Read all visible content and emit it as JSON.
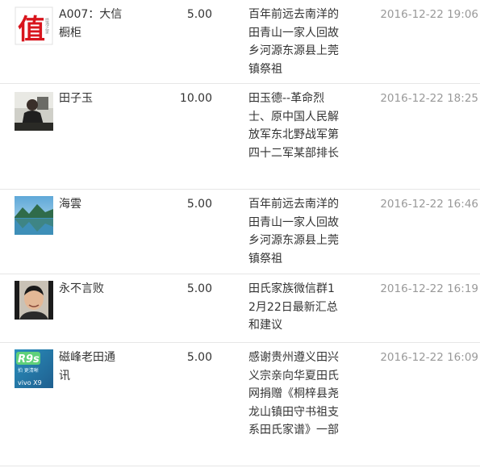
{
  "rows": [
    {
      "avatar": "zhi-calligraphy-avatar-icon",
      "name": "A007：大信橱柜",
      "amount": "5.00",
      "message": "百年前远去南洋的田青山一家人回故乡河源东源县上莞镇祭祖",
      "time": "2016-12-22 19:06"
    },
    {
      "avatar": "person-photo-avatar-icon",
      "name": "田子玉",
      "amount": "10.00",
      "message": "田玉德--革命烈士、原中国人民解放军东北野战军第四十二军某部排长",
      "time": "2016-12-22 18:25"
    },
    {
      "avatar": "mountain-lake-avatar-icon",
      "name": "海雲",
      "amount": "5.00",
      "message": "百年前远去南洋的田青山一家人回故乡河源东源县上莞镇祭祖",
      "time": "2016-12-22 16:46"
    },
    {
      "avatar": "man-portrait-avatar-icon",
      "name": "永不言败",
      "amount": "5.00",
      "message": "田氏家族微信群12月22日最新汇总和建议",
      "time": "2016-12-22 16:19"
    },
    {
      "avatar": "vivo-r9s-avatar-icon",
      "name": "磁峰老田通讯",
      "amount": "5.00",
      "message": "感谢贵州遵义田兴义宗亲向华夏田氏网捐赠《桐梓县尧龙山镇田守书祖支系田氏家谱》一部",
      "time": "2016-12-22 16:09"
    }
  ],
  "avatar_text": {
    "zhi_char": "值",
    "zhi_side": "给海之家",
    "r9s": "R9s",
    "r9s_sub": "拍 更清晰",
    "vivo": "vivo X9"
  }
}
